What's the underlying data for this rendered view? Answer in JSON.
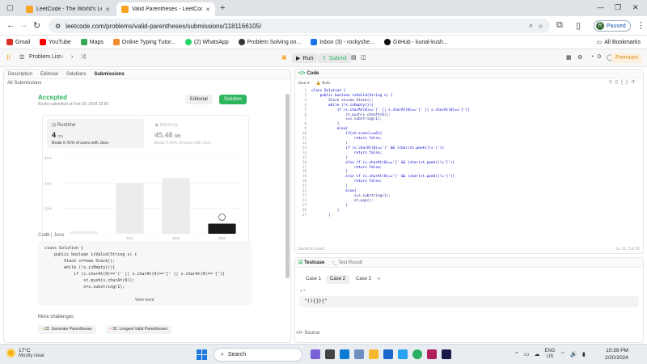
{
  "browser": {
    "tabs": [
      {
        "title": "LeetCode - The World's Leading"
      },
      {
        "title": "Valid Parentheses - LeetCode"
      }
    ],
    "url": "leetcode.com/problems/valid-parentheses/submissions/1181166105/",
    "profile_status": "Paused",
    "profile_initial": "R",
    "bookmarks": [
      "Gmail",
      "YouTube",
      "Maps",
      "Online Typing Tutor...",
      "(2) WhatsApp",
      "Problem Solving on...",
      "Inbox (3) - rockyshe...",
      "GitHub - kunal-kush..."
    ],
    "all_bookmarks": "All Bookmarks"
  },
  "lc_header": {
    "problem_list": "Problem List",
    "run": "Run",
    "submit": "Submit",
    "streak": "0",
    "premium": "Premium"
  },
  "left": {
    "tabs": [
      "Description",
      "Editorial",
      "Solutions",
      "Submissions"
    ],
    "back": "All Submissions",
    "status": "Accepted",
    "meta": "Rocky submitted at Feb 20, 2024 22:56",
    "editorial_btn": "Editorial",
    "solution_btn": "Solution",
    "runtime_label": "Runtime",
    "runtime_value": "4",
    "runtime_unit": "ms",
    "runtime_beats": "Beats 6.41% of users with Java",
    "memory_label": "Memory",
    "memory_value": "45.48",
    "memory_unit": "MB",
    "memory_beats": "Beats 5.84% of users with Java",
    "code_header": "Code | Java",
    "code": "class Solution {\n    public boolean isValid(String s) {\n        Stack st=new Stack();\n        while (!s.isEmpty()){\n            if (s.charAt(0)=='(' || s.charAt(0)=='[' || s.charAt(0)=='{'){\n                st.push(s.charAt(0));\n                s=s.substring(1);",
    "view_more": "View more",
    "more_challenges": "More challenges",
    "challenges": [
      "22. Generate Parentheses",
      "32. Longest Valid Parentheses"
    ]
  },
  "chart_data": {
    "type": "bar",
    "categories": [
      "",
      "1ms",
      "2ms",
      "3ms"
    ],
    "values": [
      2,
      40,
      44,
      8
    ],
    "ylim": [
      0,
      60
    ],
    "y_ticks": [
      "60%",
      "40%",
      "20%",
      "0%"
    ],
    "highlight_index": 3,
    "colors": {
      "bar": "#ececec",
      "highlight": "#1a1a1a"
    }
  },
  "editor": {
    "title": "Code",
    "language": "Java",
    "auto": "Auto",
    "lines": [
      "class Solution {",
      "    public boolean isValid(String s) {",
      "        Stack st=new Stack();",
      "        while (!s.isEmpty()){",
      "            if (s.charAt(0)=='(' || s.charAt(0)=='[' || s.charAt(0)=='{'){",
      "                st.push(s.charAt(0));",
      "                s=s.substring(1);",
      "            }",
      "            else{",
      "                if(st.size()==0){",
      "                    return false;",
      "                }",
      "                if (s.charAt(0)==')' && (char)st.peek()!='('){",
      "                    return false;",
      "                }",
      "                else if (s.charAt(0)==']' && (char)st.peek()!='['){",
      "                    return false;",
      "                }",
      "                else if (s.charAt(0)=='}' && (char)st.peek()!='{'){",
      "                    return false;",
      "                }",
      "                else{",
      "                    s=s.substring(1);",
      "                    st.pop();",
      "                }",
      "            }",
      "        }"
    ],
    "saved": "Saved to cloud",
    "cursor": "Ln 11, Col 36"
  },
  "testcase": {
    "tab_testcase": "Testcase",
    "tab_result": "Test Result",
    "cases": [
      "Case 1",
      "Case 2",
      "Case 3"
    ],
    "param_label": "s =",
    "param_value": "\"(){}}{\"",
    "source": "Source"
  },
  "taskbar": {
    "temp": "17°C",
    "condition": "Mostly clear",
    "search": "Search",
    "lang": "ENG",
    "region": "US",
    "time": "10:39 PM",
    "date": "2/20/2024"
  }
}
